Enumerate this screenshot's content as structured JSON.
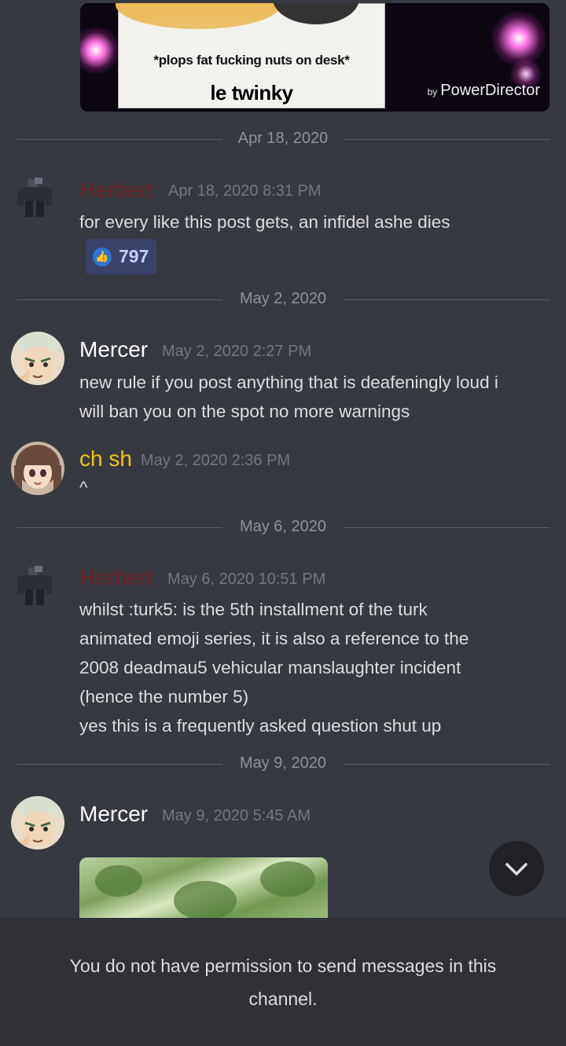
{
  "top_embed": {
    "caption_line1": "*plops fat fucking nuts on desk*",
    "caption_line2": "le twinky",
    "watermark_by": "by",
    "watermark_brand": "PowerDirector"
  },
  "separators": [
    "Apr 18, 2020",
    "May 2, 2020",
    "May 6, 2020",
    "May 9, 2020"
  ],
  "messages": [
    {
      "author": "Herbert",
      "author_color": "#6b1f1f",
      "timestamp": "Apr 18, 2020 8:31 PM",
      "lines": [
        "for every like this post gets, an infidel ashe dies"
      ],
      "reaction": {
        "icon": "thumbs-up",
        "count": "797"
      }
    },
    {
      "author": "Mercer",
      "author_color": "#ffffff",
      "timestamp": "May 2, 2020 2:27 PM",
      "lines": [
        "new rule if you post anything that is deafeningly loud i",
        "will ban you on the spot no more warnings"
      ]
    },
    {
      "author": "ch sh",
      "author_color": "#f1c40f",
      "timestamp": "May 2, 2020 2:36 PM",
      "lines": [
        "^"
      ]
    },
    {
      "author": "Herbert",
      "author_color": "#6b1f1f",
      "timestamp": "May 6, 2020 10:51 PM",
      "lines": [
        "whilst :turk5: is the 5th installment of the turk",
        "animated emoji series, it is also a reference to the",
        "2008 deadmau5 vehicular manslaughter incident",
        "(hence the number 5)",
        "yes this is a frequently asked question shut up"
      ]
    },
    {
      "author": "Mercer",
      "author_color": "#ffffff",
      "timestamp": "May 9, 2020 5:45 AM",
      "lines": []
    }
  ],
  "footer": {
    "line1": "You do not have permission to send messages in this",
    "line2": "channel."
  },
  "colors": {
    "background": "#36393f",
    "footer_background": "#2f3136",
    "reaction_background": "#3b4269",
    "timestamp": "#72767d"
  }
}
